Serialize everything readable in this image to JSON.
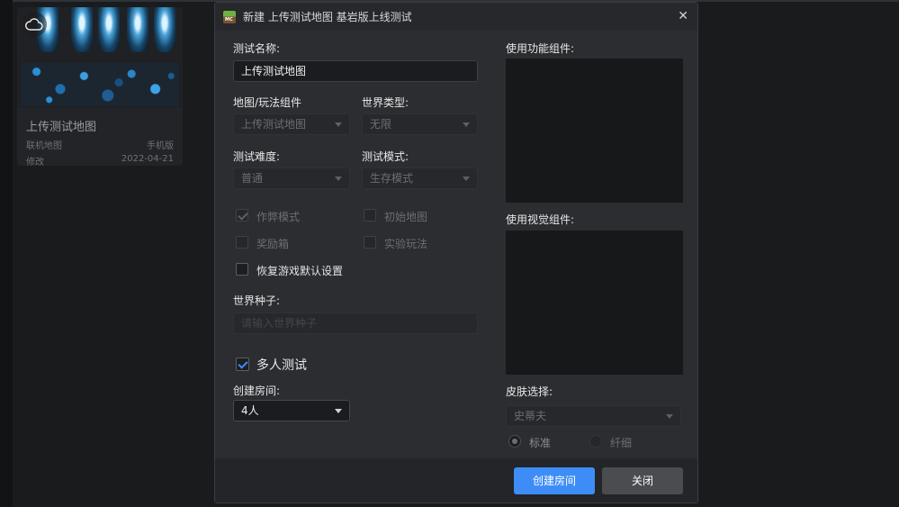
{
  "map_card": {
    "title": "上传测试地图",
    "type": "联机地图",
    "platform": "手机版",
    "modified_label": "修改",
    "modified_date": "2022-04-21"
  },
  "dialog": {
    "title": "新建 上传测试地图  基岩版上线测试",
    "close_glyph": "✕",
    "test_name_label": "测试名称:",
    "test_name_value": "上传测试地图",
    "map_component_label": "地图/玩法组件",
    "map_component_value": "上传测试地图",
    "world_type_label": "世界类型:",
    "world_type_value": "无限",
    "difficulty_label": "测试难度:",
    "difficulty_value": "普通",
    "mode_label": "测试模式:",
    "mode_value": "生存模式",
    "options": {
      "cheat_mode": "作弊模式",
      "initial_map": "初始地图",
      "bonus_chest": "奖励箱",
      "experimental": "实验玩法",
      "restore_defaults": "恢复游戏默认设置"
    },
    "seed_label": "世界种子:",
    "seed_placeholder": "请输入世界种子",
    "multiplayer_label": "多人测试",
    "create_room_label": "创建房间:",
    "room_size_value": "4人",
    "function_components_label": "使用功能组件:",
    "visual_components_label": "使用视觉组件:",
    "skin_label": "皮肤选择:",
    "skin_value": "史蒂夫",
    "skin_standard": "标准",
    "skin_slim": "纤细",
    "create_button": "创建房间",
    "close_button": "关闭"
  },
  "colors": {
    "accent": "#3e8df7",
    "dialog_bg": "#2b2d31",
    "panel_bg": "#17181a"
  }
}
